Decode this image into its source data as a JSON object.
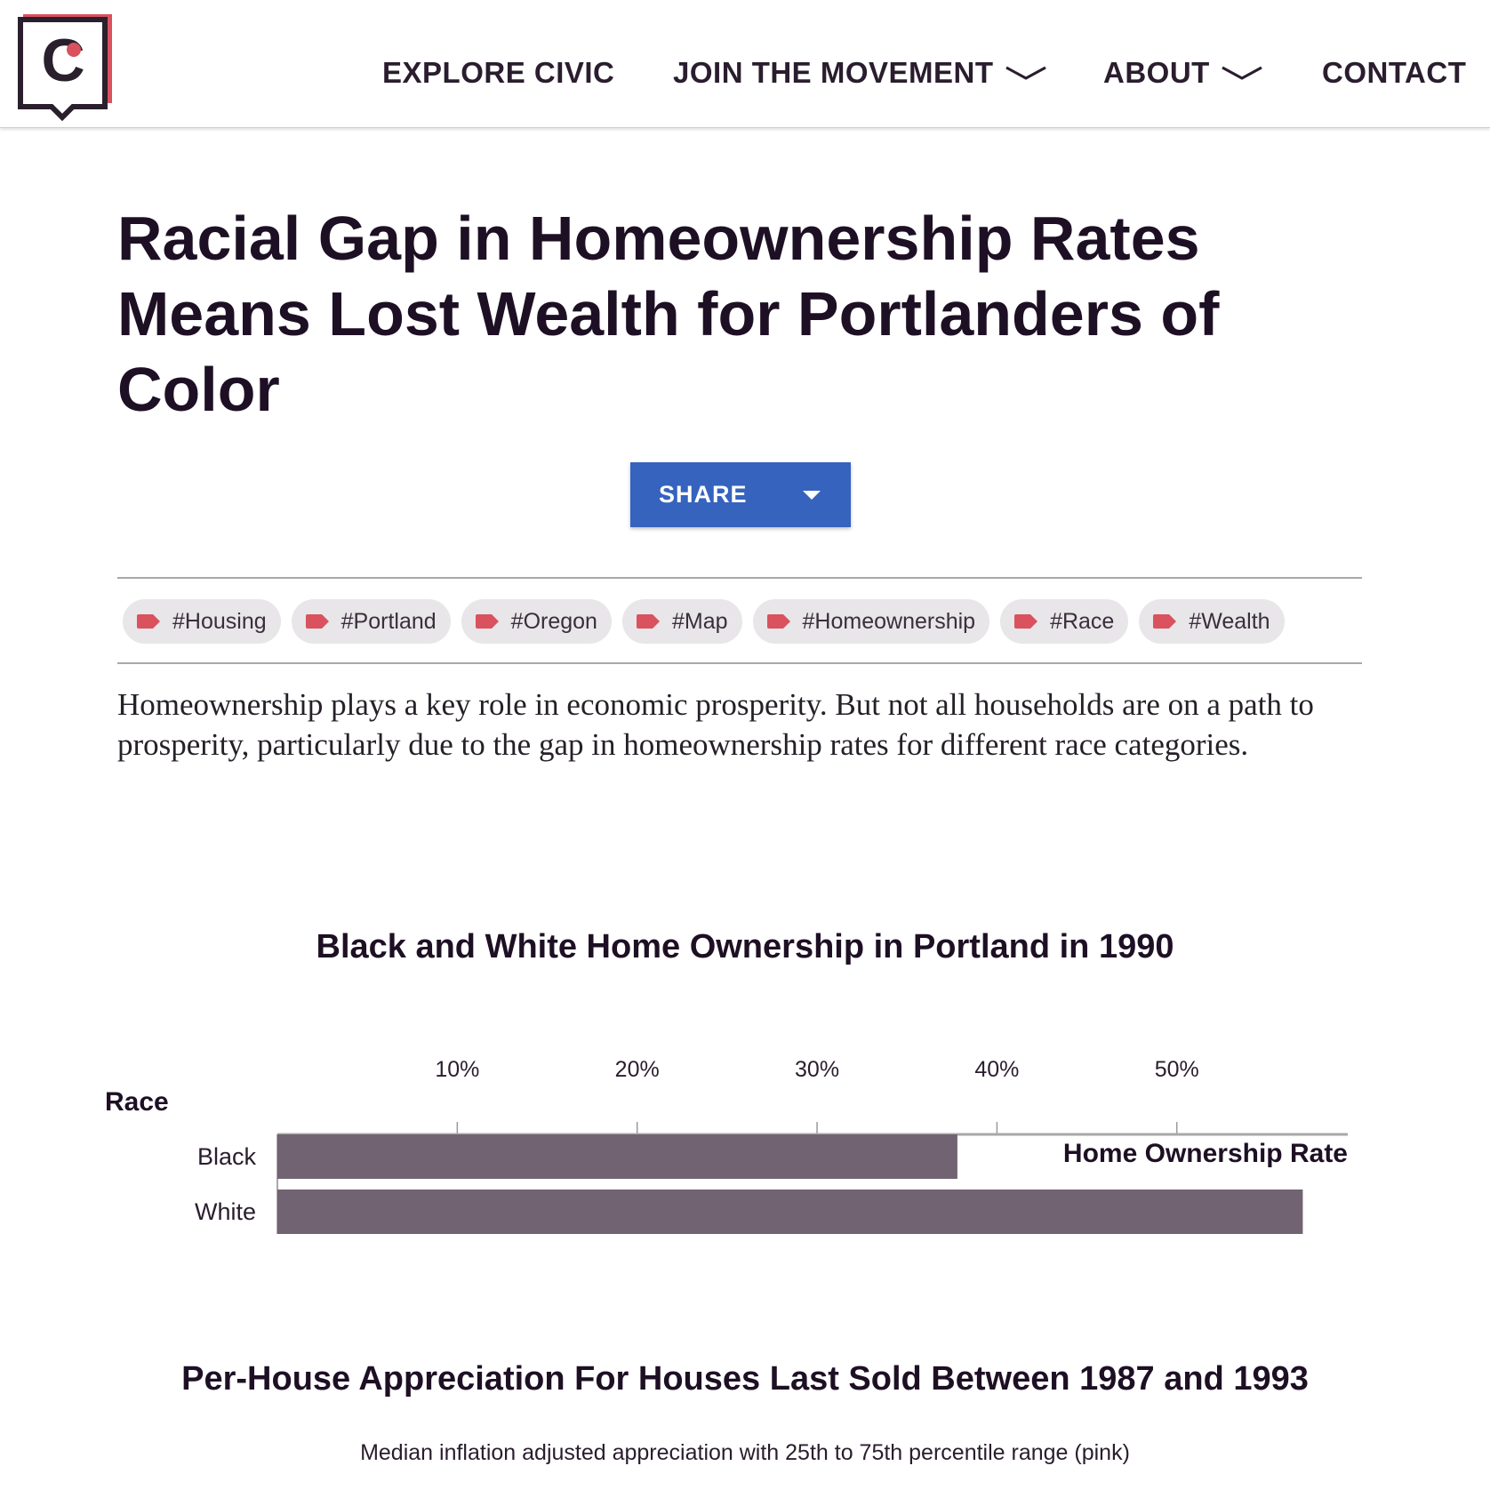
{
  "header": {
    "logo_letter": "C",
    "nav": [
      {
        "label": "EXPLORE CIVIC",
        "has_dropdown": false
      },
      {
        "label": "JOIN THE MOVEMENT",
        "has_dropdown": true
      },
      {
        "label": "ABOUT",
        "has_dropdown": true
      },
      {
        "label": "CONTACT",
        "has_dropdown": false
      }
    ]
  },
  "article": {
    "title": "Racial Gap in Homeownership Rates Means Lost Wealth for Portlanders of Color",
    "share_label": "SHARE",
    "tags": [
      "#Housing",
      "#Portland",
      "#Oregon",
      "#Map",
      "#Homeownership",
      "#Race",
      "#Wealth"
    ],
    "intro": "Homeownership plays a key role in economic prosperity. But not all households are on a path to prosperity, particularly due to the gap in homeownership rates for different race categories."
  },
  "colors": {
    "brand_dark": "#2a1f2d",
    "brand_accent": "#d9525e",
    "share_button": "#3563be",
    "bar_fill": "#716371",
    "tag_background": "#e8e6e8"
  },
  "chart_data": [
    {
      "type": "bar",
      "orientation": "horizontal",
      "title": "Black and White Home Ownership in Portland in 1990",
      "categories": [
        "Black",
        "White"
      ],
      "values": [
        37.8,
        57
      ],
      "ylabel": "Race",
      "xlabel": "Home Ownership Rate",
      "xlim": [
        0,
        59.5
      ],
      "ticks": [
        10,
        20,
        30,
        40,
        50
      ],
      "tick_labels": [
        "10%",
        "20%",
        "30%",
        "40%",
        "50%"
      ],
      "grid": false
    }
  ],
  "chart2": {
    "title": "Per-House Appreciation For Houses Last Sold Between 1987 and 1993",
    "subtitle": "Median inflation adjusted appreciation with 25th to 75th percentile range (pink)"
  }
}
